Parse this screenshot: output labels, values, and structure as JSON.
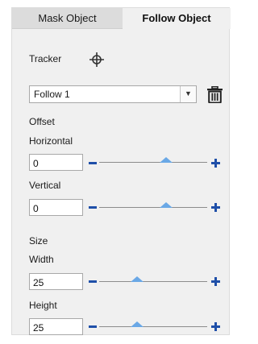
{
  "tabs": [
    {
      "label": "Mask Object",
      "active": false
    },
    {
      "label": "Follow Object",
      "active": true
    }
  ],
  "tracker": {
    "label": "Tracker",
    "icon": "crosshair-icon"
  },
  "follow_select": {
    "value": "Follow 1",
    "icon": "chevron-down-icon"
  },
  "delete": {
    "icon": "trash-icon"
  },
  "offset": {
    "section_label": "Offset",
    "horizontal": {
      "label": "Horizontal",
      "value": "0",
      "slider_fraction": 0.62
    },
    "vertical": {
      "label": "Vertical",
      "value": "0",
      "slider_fraction": 0.62
    }
  },
  "size": {
    "section_label": "Size",
    "width": {
      "label": "Width",
      "value": "25",
      "slider_fraction": 0.35
    },
    "height": {
      "label": "Height",
      "value": "25",
      "slider_fraction": 0.35
    }
  },
  "colors": {
    "accent": "#1f4fa8",
    "thumb": "#6aa8e6",
    "panel": "#f0f0f0"
  }
}
